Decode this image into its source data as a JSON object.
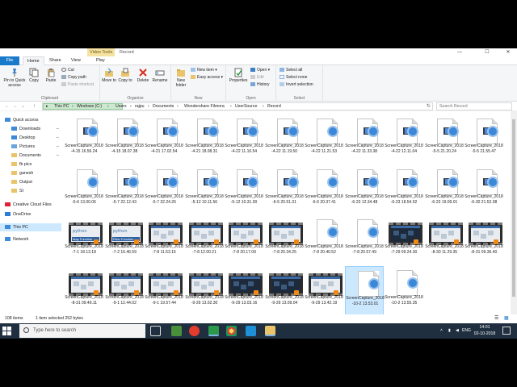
{
  "window": {
    "context_tab": "Video Tools",
    "title": "Record",
    "controls": [
      "—",
      "☐",
      "✕"
    ]
  },
  "ribbon_tabs": [
    "File",
    "Home",
    "Share",
    "View",
    "Play"
  ],
  "ribbon": {
    "clipboard": {
      "pin_label": "Pin to Quick access",
      "copy": "Copy",
      "paste": "Paste",
      "cut": "Cut",
      "copy_path": "Copy path",
      "paste_shortcut": "Paste shortcut",
      "group": "Clipboard"
    },
    "organize": {
      "move_to": "Move to",
      "copy_to": "Copy to",
      "delete": "Delete",
      "rename": "Rename",
      "group": "Organize"
    },
    "new": {
      "new_folder": "New folder",
      "new_item": "New item ▾",
      "easy_access": "Easy access ▾",
      "group": "New"
    },
    "open": {
      "properties": "Properties",
      "open": "Open ▾",
      "edit": "Edit",
      "history": "History",
      "group": "Open"
    },
    "select": {
      "select_all": "Select all",
      "select_none": "Select none",
      "invert": "Invert selection",
      "group": "Select"
    }
  },
  "address": {
    "breadcrumbs": [
      "This PC",
      "Windows (C:)",
      "Users",
      "rajpu",
      "Documents",
      "Wondershare Filmora",
      "UserSource",
      "Record"
    ],
    "search_placeholder": "Search Record"
  },
  "nav": [
    {
      "label": "Quick access",
      "pinned": false
    },
    {
      "label": "Downloads",
      "pinned": true
    },
    {
      "label": "Desktop",
      "pinned": true
    },
    {
      "label": "Pictures",
      "pinned": true
    },
    {
      "label": "Documents",
      "pinned": true
    },
    {
      "label": "fb pics",
      "pinned": false
    },
    {
      "label": "ganesh",
      "pinned": false
    },
    {
      "label": "Output",
      "pinned": false
    },
    {
      "label": "SI",
      "pinned": false
    },
    {
      "label": "Creative Cloud Files",
      "pinned": false
    },
    {
      "label": "OneDrive",
      "pinned": false
    },
    {
      "label": "This PC",
      "pinned": false
    },
    {
      "label": "Network",
      "pinned": false
    }
  ],
  "files": [
    {
      "name": "ScreenCapture_2018-4-15 16.56.24",
      "kind": "video-doc"
    },
    {
      "name": "ScreenCapture_2018-4-15 18.07.38",
      "kind": "video-doc"
    },
    {
      "name": "ScreenCapture_2018-4-21 17.02.54",
      "kind": "video-doc"
    },
    {
      "name": "ScreenCapture_2018-4-21 18.08.31",
      "kind": "video-doc"
    },
    {
      "name": "ScreenCapture_2018-4-22 11.16.54",
      "kind": "video-doc"
    },
    {
      "name": "ScreenCapture_2018-4-22 11.19.50",
      "kind": "video-doc"
    },
    {
      "name": "ScreenCapture_2018-4-22 11.21.53",
      "kind": "audio-doc"
    },
    {
      "name": "ScreenCapture_2018-4-22 11.33.38",
      "kind": "video-doc"
    },
    {
      "name": "ScreenCapture_2018-4-22 12.11.04",
      "kind": "video-doc"
    },
    {
      "name": "ScreenCapture_2018-5-5 21.20.24",
      "kind": "video-doc"
    },
    {
      "name": "ScreenCapture_2018-5-5 21.55.47",
      "kind": "video-doc"
    },
    {
      "name": "ScreenCapture_2018-5-6 13.00.06",
      "kind": "audio-doc"
    },
    {
      "name": "ScreenCapture_2018-5-7 22.12.43",
      "kind": "video-doc"
    },
    {
      "name": "ScreenCapture_2018-5-7 22.24.26",
      "kind": "video-doc"
    },
    {
      "name": "ScreenCapture_2018-5-12 10.11.56",
      "kind": "video-doc"
    },
    {
      "name": "ScreenCapture_2018-5-12 10.31.00",
      "kind": "video-doc"
    },
    {
      "name": "ScreenCapture_2018-6-5 20.51.31",
      "kind": "video-doc"
    },
    {
      "name": "ScreenCapture_2018-6-6 20.37.41",
      "kind": "audio-doc"
    },
    {
      "name": "ScreenCapture_2018-6-23 12.34.48",
      "kind": "video-doc"
    },
    {
      "name": "ScreenCapture_2018-6-23 18.54.02",
      "kind": "video-doc"
    },
    {
      "name": "ScreenCapture_2018-6-23 19.09.01",
      "kind": "video-doc"
    },
    {
      "name": "ScreenCapture_2018-6-30 21.52.08",
      "kind": "video-doc"
    },
    {
      "name": "ScreenCapture_2018-7-1 18.13.18",
      "kind": "film",
      "screen": "python",
      "caption": "Map Function"
    },
    {
      "name": "ScreenCapture_2018-7-2 16.46.59",
      "kind": "film",
      "screen": "python",
      "caption": "Filter Function"
    },
    {
      "name": "ScreenCapture_2018-7-8 11.53.16",
      "kind": "film",
      "screen": "light"
    },
    {
      "name": "ScreenCapture_2018-7-8 12.00.21",
      "kind": "film",
      "screen": "light"
    },
    {
      "name": "ScreenCapture_2018-7-8 20.17.09",
      "kind": "film",
      "screen": "light"
    },
    {
      "name": "ScreenCapture_2018-7-8 20.34.25",
      "kind": "film",
      "screen": "light"
    },
    {
      "name": "ScreenCapture_2018-7-8 20.40.52",
      "kind": "audio-doc"
    },
    {
      "name": "ScreenCapture_2018-7-8 20.57.49",
      "kind": "audio-doc"
    },
    {
      "name": "ScreenCapture_2018-7-29 09.24.30",
      "kind": "film",
      "screen": "dark"
    },
    {
      "name": "ScreenCapture_2018-8-30 11.29.35",
      "kind": "film",
      "screen": "light"
    },
    {
      "name": "ScreenCapture_2018-8-31 09.36.40",
      "kind": "film",
      "screen": "light"
    },
    {
      "name": "ScreenCapture_2018-8-31 09.49.11",
      "kind": "film",
      "screen": "light"
    },
    {
      "name": "ScreenCapture_2018-9-1 12.44.02",
      "kind": "film",
      "screen": "light"
    },
    {
      "name": "ScreenCapture_2018-9-1 19.57.44",
      "kind": "film",
      "screen": "light"
    },
    {
      "name": "ScreenCapture_2018-9-29 13.02.30",
      "kind": "film",
      "screen": "light"
    },
    {
      "name": "ScreenCapture_2018-9-29 13.03.16",
      "kind": "film",
      "screen": "dark"
    },
    {
      "name": "ScreenCapture_2018-9-29 13.09.04",
      "kind": "film",
      "screen": "dark"
    },
    {
      "name": "ScreenCapture_2018-9-29 13.42.19",
      "kind": "film",
      "screen": "light"
    },
    {
      "name": "ScreenCapture_2018-10-2 13.53.01",
      "kind": "audio-doc",
      "selected": true
    },
    {
      "name": "ScreenCapture_2018-10-2 13.55.35",
      "kind": "audio-doc"
    }
  ],
  "status": {
    "count": "108 items",
    "selection": "1 item selected  252 bytes"
  },
  "taskbar": {
    "search_placeholder": "Type here to search",
    "time": "14:01",
    "date": "02-10-2018",
    "lang": "ENG"
  },
  "colors": {
    "accent": "#1979ca",
    "selection": "#cce8ff",
    "taskbar": "#1f2f3f",
    "context_tab": "#f6e2a0"
  }
}
